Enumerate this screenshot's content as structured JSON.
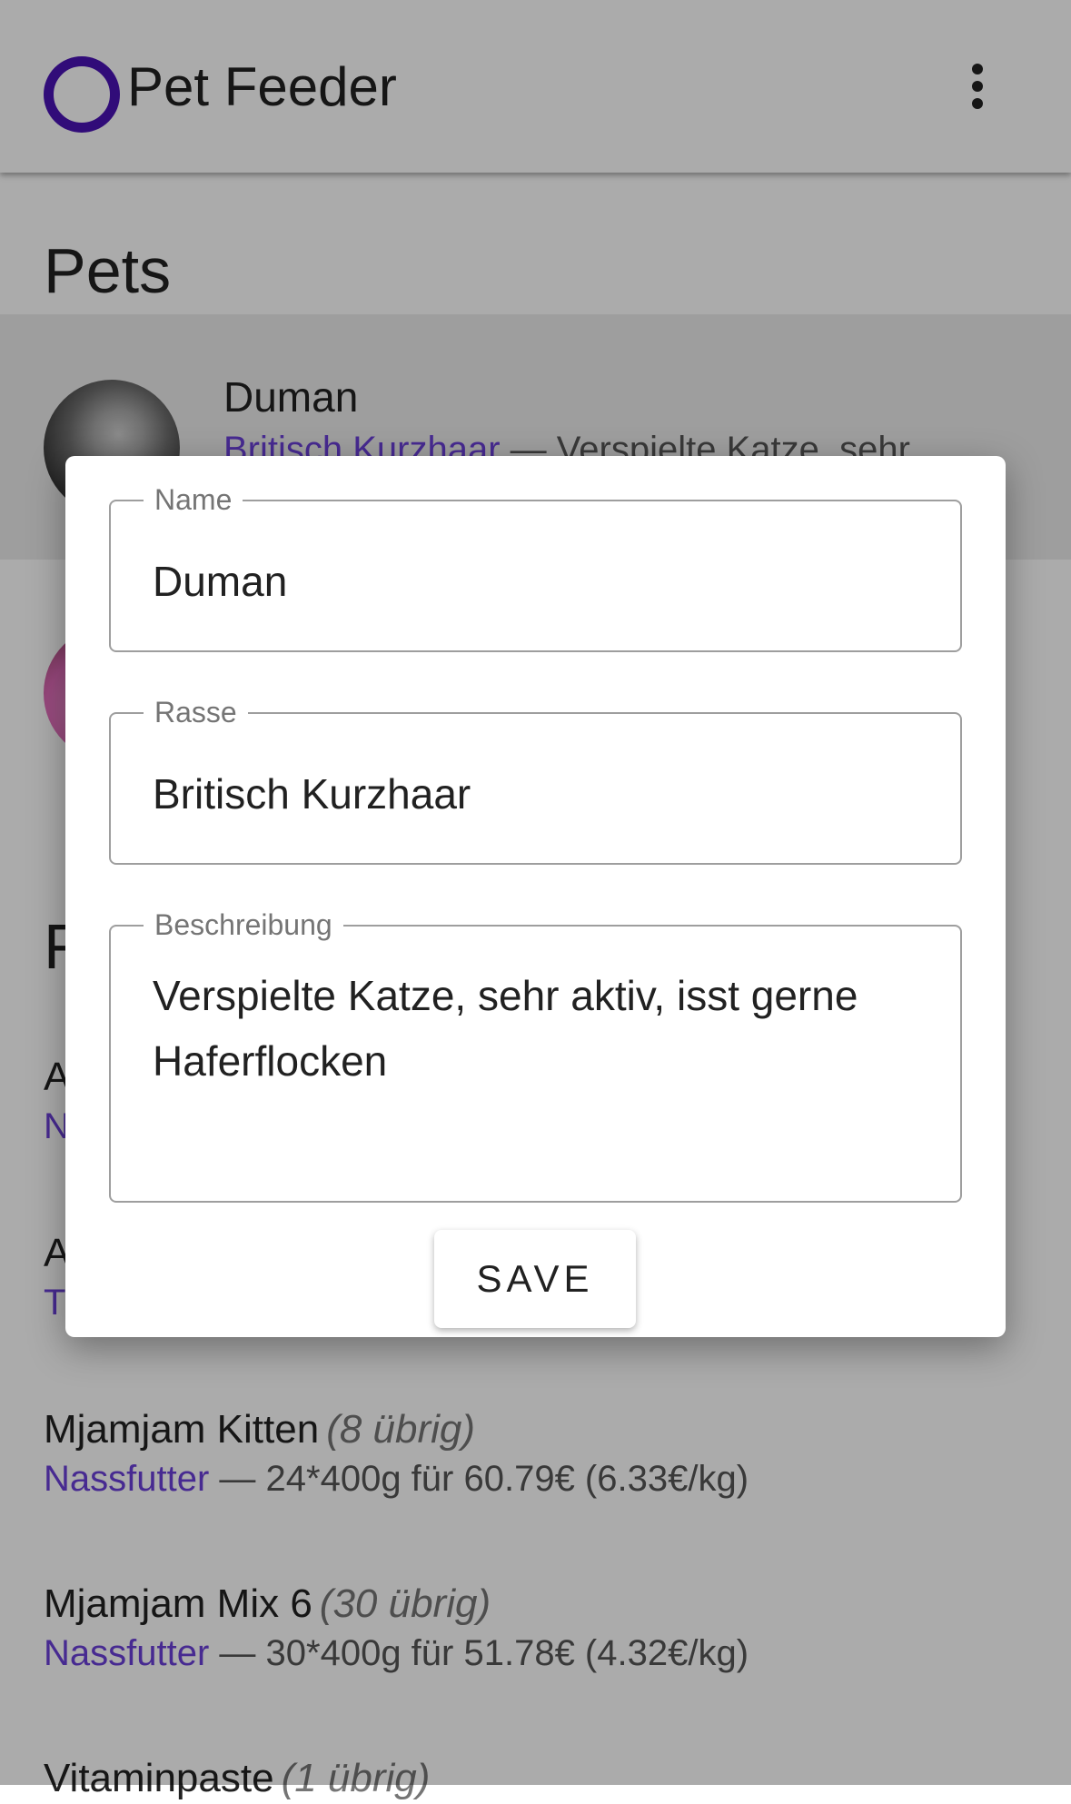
{
  "app_bar": {
    "title": "Pet Feeder",
    "logo_icon": "ring-logo-icon",
    "menu_icon": "more-vert-icon",
    "logo_color": "#4a12b5"
  },
  "pets": {
    "heading": "Pets",
    "items": [
      {
        "name": "Duman",
        "breed": "Britisch Kurzhaar",
        "separator": " — ",
        "description_preview": "Verspielte Katze, sehr"
      },
      {
        "name": "",
        "breed": "",
        "description_preview": ""
      }
    ]
  },
  "foods": {
    "heading_partial": "F",
    "items": [
      {
        "name": "A",
        "count": "",
        "category": "N",
        "details": ""
      },
      {
        "name": "A",
        "count": "",
        "category": "T",
        "details": ""
      },
      {
        "name": "Mjamjam Kitten",
        "count": "(8 übrig)",
        "category": "Nassfutter",
        "details": " — 24*400g für 60.79€ (6.33€/kg)"
      },
      {
        "name": "Mjamjam Mix 6",
        "count": "(30 übrig)",
        "category": "Nassfutter",
        "details": " — 30*400g für 51.78€ (4.32€/kg)"
      },
      {
        "name": "Vitaminpaste",
        "count": "(1 übrig)",
        "category": "",
        "details": ""
      }
    ]
  },
  "dialog": {
    "name_field": {
      "label": "Name",
      "value": "Duman"
    },
    "breed_field": {
      "label": "Rasse",
      "value": "Britisch Kurzhaar"
    },
    "description_field": {
      "label": "Beschreibung",
      "value": "Verspielte Katze, sehr aktiv, isst gerne Haferflocken"
    },
    "save_label": "SAVE"
  },
  "colors": {
    "accent": "#6a3fd8",
    "scrim": "rgba(0,0,0,0.33)"
  }
}
